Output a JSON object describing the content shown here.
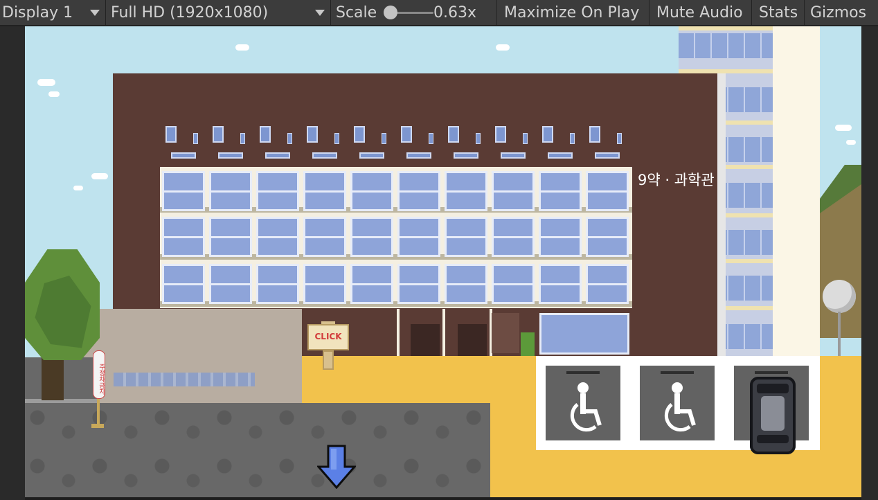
{
  "toolbar": {
    "display": "Display 1",
    "resolution": "Full HD (1920x1080)",
    "scale_label": "Scale",
    "scale_value": "0.63x",
    "maximize": "Maximize On Play",
    "mute": "Mute Audio",
    "stats": "Stats",
    "gizmos": "Gizmos"
  },
  "scene": {
    "building_sign": "9약 · 과학관",
    "click_sign": "CLICK",
    "no_parking_sign": "주정차금지",
    "nav_arrow": "down-arrow-icon",
    "parking_icons": [
      "wheelchair-icon",
      "wheelchair-icon",
      "car-icon"
    ]
  },
  "colors": {
    "sky": "#bfe3ee",
    "building": "#5a3b34",
    "ground": "#f2c24c",
    "asphalt": "#686868",
    "arrow": "#5b80e6"
  }
}
